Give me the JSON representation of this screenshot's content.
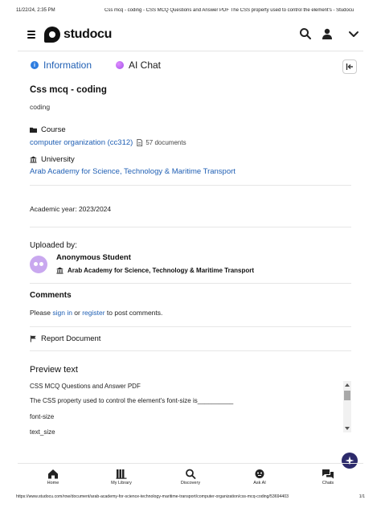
{
  "print_header": {
    "date": "11/22/24, 2:35 PM",
    "title": "Css mcq - coding - CSS MCQ Questions and Answer PDF The CSS property used to control the element's - Studocu"
  },
  "topbar": {
    "logo_text": "studocu"
  },
  "tabs": [
    {
      "label": "Information",
      "active": true
    },
    {
      "label": "AI Chat",
      "active": false
    }
  ],
  "document": {
    "title": "Css mcq - coding",
    "subtitle": "coding",
    "course_label": "Course",
    "course_name": "computer organization (cc312)",
    "course_docs": "57 documents",
    "university_label": "University",
    "university_name": "Arab Academy for Science, Technology & Maritime Transport",
    "academic_year": "Academic year: 2023/2024"
  },
  "uploader": {
    "heading": "Uploaded by:",
    "name": "Anonymous Student",
    "university": "Arab Academy for Science, Technology & Maritime Transport"
  },
  "comments": {
    "title": "Comments",
    "prefix": "Please ",
    "sign_in": "sign in",
    "middle": " or ",
    "register": "register",
    "suffix": " to post comments."
  },
  "report_label": "Report Document",
  "preview": {
    "title": "Preview text",
    "lines": [
      "CSS MCQ Questions and Answer PDF",
      "The CSS property used to control the element's font-size is__________",
      "font-size",
      "text_size"
    ]
  },
  "bottom_nav": [
    {
      "label": "Home",
      "icon": "home-icon"
    },
    {
      "label": "My Library",
      "icon": "library-icon"
    },
    {
      "label": "Discovery",
      "icon": "discovery-icon"
    },
    {
      "label": "Ask AI",
      "icon": "ask-ai-icon"
    },
    {
      "label": "Chats",
      "icon": "chats-icon"
    }
  ],
  "print_footer": {
    "url": "https://www.studocu.com/row/document/arab-academy-for-science-technology-maritime-transport/computer-organization/css-mcq-coding/53694403",
    "page": "1/1"
  },
  "colors": {
    "link": "#1f5fb4",
    "ai_accent": "#a252e8",
    "fab": "#2c2a6b"
  }
}
